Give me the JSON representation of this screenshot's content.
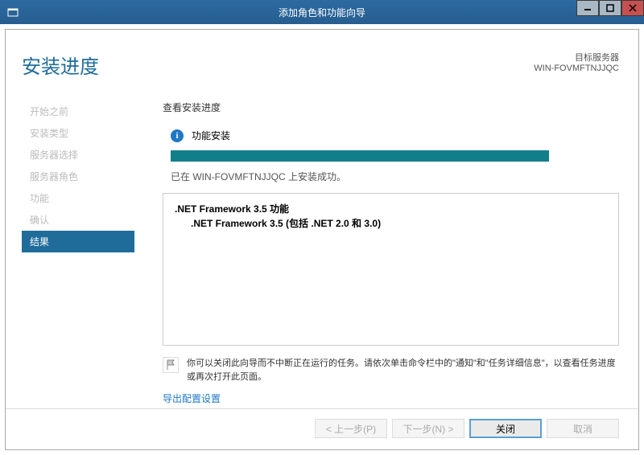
{
  "window": {
    "title": "添加角色和功能向导"
  },
  "header": {
    "page_title": "安装进度",
    "server_label": "目标服务器",
    "server_name": "WIN-FOVMFTNJJQC"
  },
  "sidebar": {
    "items": [
      {
        "label": "开始之前"
      },
      {
        "label": "安装类型"
      },
      {
        "label": "服务器选择"
      },
      {
        "label": "服务器角色"
      },
      {
        "label": "功能"
      },
      {
        "label": "确认"
      },
      {
        "label": "结果"
      }
    ]
  },
  "main": {
    "view_label": "查看安装进度",
    "status_heading": "功能安装",
    "progress_msg": "已在 WIN-FOVMFTNJJQC 上安装成功。",
    "features": {
      "f1": ".NET Framework 3.5 功能",
      "f2": ".NET Framework 3.5 (包括 .NET 2.0 和 3.0)"
    },
    "note": "你可以关闭此向导而不中断正在运行的任务。请依次单击命令栏中的\"通知\"和\"任务详细信息\"，以查看任务进度或再次打开此页面。",
    "export_link": "导出配置设置"
  },
  "buttons": {
    "prev": "< 上一步(P)",
    "next": "下一步(N) >",
    "close": "关闭",
    "cancel": "取消"
  }
}
